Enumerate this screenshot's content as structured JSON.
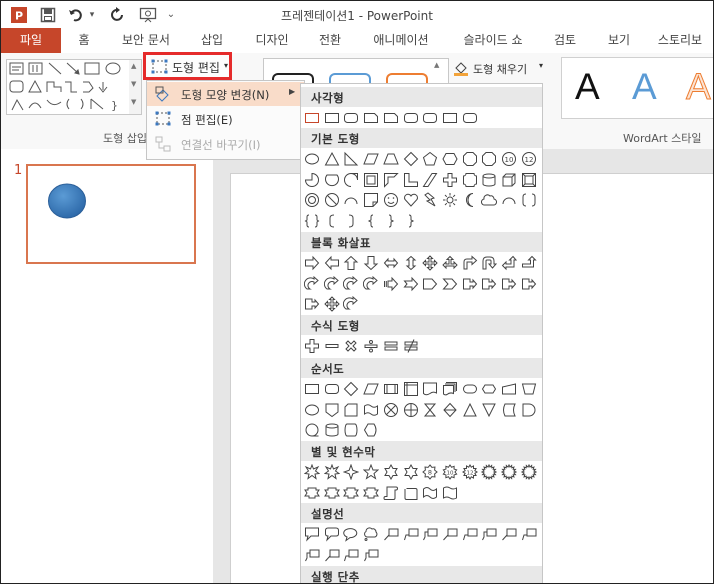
{
  "window": {
    "title": "프레젠테이션1 - PowerPoint"
  },
  "quick_access": [
    {
      "name": "powerpoint-logo-icon",
      "glyph": "P"
    },
    {
      "name": "save-icon",
      "glyph": "▪"
    },
    {
      "name": "undo-icon",
      "glyph": "↶"
    },
    {
      "name": "undo-dropdown-icon",
      "glyph": "▾"
    },
    {
      "name": "redo-icon",
      "glyph": "↻"
    },
    {
      "name": "present-icon",
      "glyph": "⊡"
    },
    {
      "name": "customize-icon",
      "glyph": "⌄"
    }
  ],
  "tabs": [
    "파일",
    "홈",
    "보안 문서",
    "삽입",
    "디자인",
    "전환",
    "애니메이션",
    "슬라이드 쇼",
    "검토",
    "보기",
    "스토리보"
  ],
  "ribbon": {
    "insert_shapes_label": "도형 삽입",
    "edit_shape_button": "도형 편집",
    "shape_fill_button": "도형 채우기",
    "wordart_label": "WordArt 스타일",
    "wordart_letters": [
      {
        "text": "A",
        "color": "#111111"
      },
      {
        "text": "A",
        "color": "#5b9bd5"
      },
      {
        "text": "A",
        "color": "#ed7d31"
      }
    ]
  },
  "edit_menu": {
    "items": [
      {
        "label": "도형 모양 변경(N)",
        "enabled": true,
        "highlighted": true,
        "has_submenu": true,
        "icon": "change-shape-icon"
      },
      {
        "label": "점 편집(E)",
        "enabled": true,
        "highlighted": false,
        "has_submenu": false,
        "icon": "edit-points-icon"
      },
      {
        "label": "연결선 바꾸기(I)",
        "enabled": false,
        "highlighted": false,
        "has_submenu": false,
        "icon": "reroute-connectors-icon"
      }
    ]
  },
  "shape_categories": [
    {
      "name": "사각형",
      "count": 9
    },
    {
      "name": "기본 도형",
      "count": 42
    },
    {
      "name": "블록 화살표",
      "count": 27
    },
    {
      "name": "수식 도형",
      "count": 6
    },
    {
      "name": "순서도",
      "count": 28
    },
    {
      "name": "별 및 현수막",
      "count": 20
    },
    {
      "name": "설명선",
      "count": 16
    },
    {
      "name": "실행 단추",
      "count": 0
    }
  ],
  "slides": [
    {
      "number": "1"
    }
  ],
  "colors": {
    "accent": "#c6462a",
    "highlight": "#e52b2b",
    "menu_hover": "#f9dcc9",
    "thumb_border": "#d9764f",
    "shape_fill": "#3b78c0"
  }
}
